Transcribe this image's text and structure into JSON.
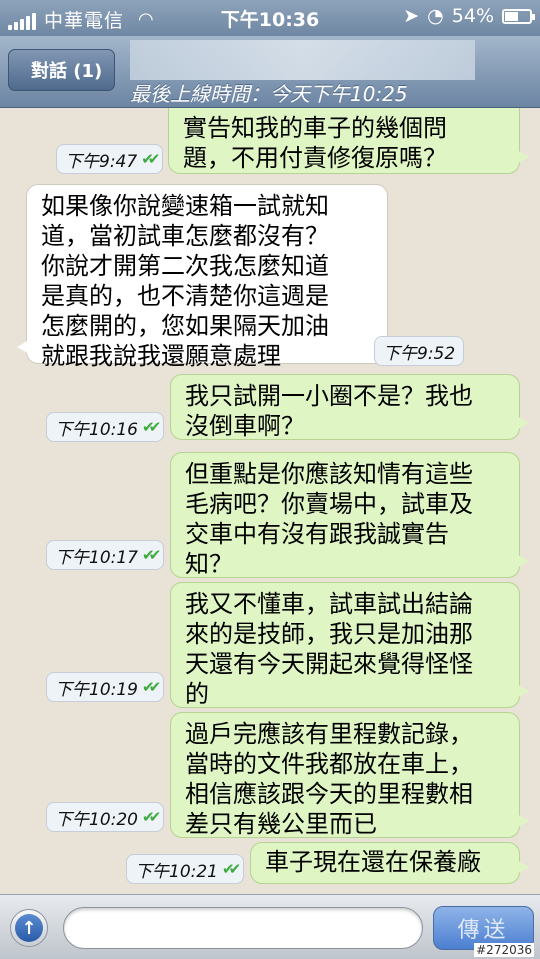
{
  "status_bar": {
    "carrier": "中華電信",
    "time": "下午10:36",
    "battery": "54%",
    "battery_level": 0.54
  },
  "header": {
    "back_label": "對話 (1)",
    "last_seen": "最後上線時間：今天下午10:25"
  },
  "messages": [
    {
      "direction": "out",
      "text_lines": [
        "實告知我的車子的幾個問",
        "題，不用付責修復原嗎？"
      ],
      "time": "下午9:47",
      "read_ticks": "✔✔"
    },
    {
      "direction": "in",
      "text_lines": [
        "如果像你說變速箱一試就知",
        "道，當初試車怎麼都沒有？",
        "你說才開第二次我怎麼知道",
        "是真的，也不清楚你這週是",
        "怎麼開的，您如果隔天加油",
        "就跟我說我還願意處理"
      ],
      "time": "下午9:52"
    },
    {
      "direction": "out",
      "text_lines": [
        "我只試開一小圈不是？我也",
        "沒倒車啊？"
      ],
      "time": "下午10:16",
      "read_ticks": "✔✔"
    },
    {
      "direction": "out",
      "text_lines": [
        "但重點是你應該知情有這些",
        "毛病吧？你賣場中，試車及",
        "交車中有沒有跟我誠實告",
        "知？"
      ],
      "time": "下午10:17",
      "read_ticks": "✔✔"
    },
    {
      "direction": "out",
      "text_lines": [
        "我又不懂車，試車試出結論",
        "來的是技師，我只是加油那",
        "天還有今天開起來覺得怪怪",
        "的"
      ],
      "time": "下午10:19",
      "read_ticks": "✔✔"
    },
    {
      "direction": "out",
      "text_lines": [
        "過戶完應該有里程數記錄，",
        "當時的文件我都放在車上，",
        "相信應該跟今天的里程數相",
        "差只有幾公里而已"
      ],
      "time": "下午10:20",
      "read_ticks": "✔✔"
    },
    {
      "direction": "out",
      "text_lines": [
        "車子現在還在保養廠"
      ],
      "time": "下午10:21",
      "read_ticks": "✔✔"
    }
  ],
  "input_bar": {
    "placeholder": "",
    "send_label": "傳送"
  },
  "watermark": "#272036"
}
